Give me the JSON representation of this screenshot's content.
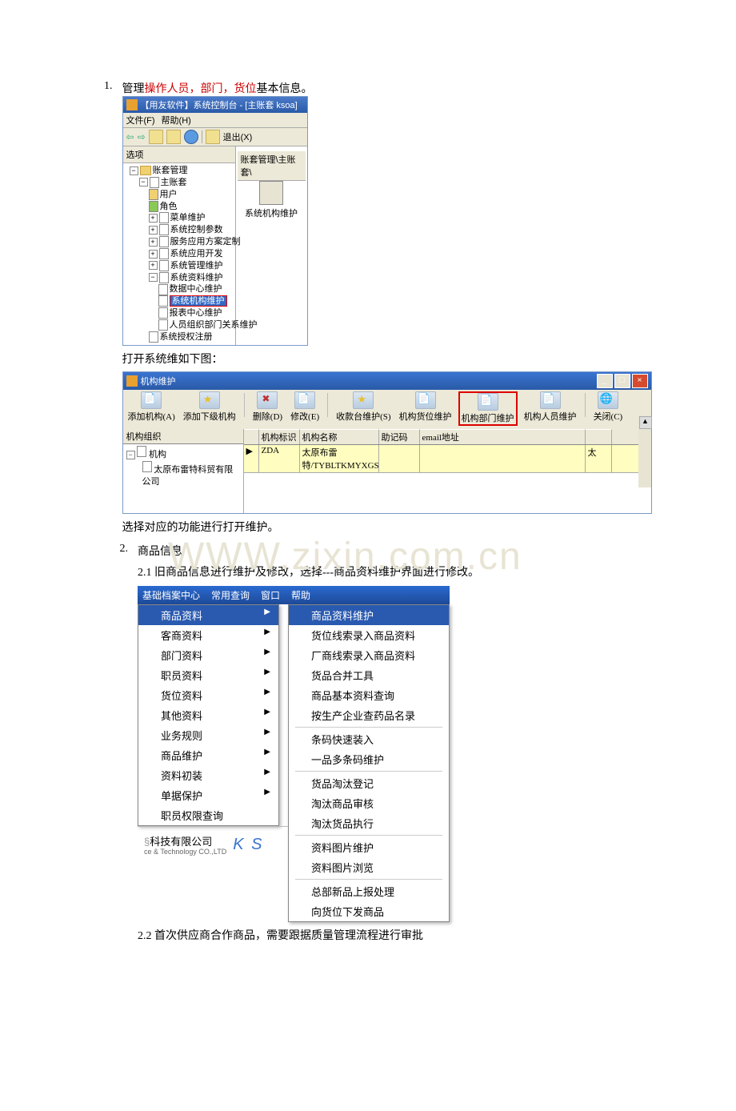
{
  "item1": {
    "number": "1.",
    "text_prefix": "管理",
    "red1": "操作人员，",
    "red2": "部门，",
    "red3": "货位",
    "text_suffix": "基本信息。"
  },
  "win1": {
    "title": "【用友软件】系统控制台 - [主账套 ksoa]",
    "menu": {
      "file": "文件(F)",
      "help": "帮助(H)"
    },
    "toolbar": {
      "exit": "退出(X)"
    },
    "left_header": "选项",
    "right_header": "账套管理\\主账套\\",
    "right_label": "系统机构维护",
    "tree": {
      "root": "账套管理",
      "main": "主账套",
      "user": "用户",
      "role": "角色",
      "menu_maint": "菜单维护",
      "sys_param": "系统控制参数",
      "svc_custom": "服务应用方案定制",
      "app_dev": "系统应用开发",
      "mgmt_maint": "系统管理维护",
      "data_maint": "系统资料维护",
      "data_center": "数据中心维护",
      "org_maint": "系统机构维护",
      "report_maint": "报表中心维护",
      "staff_rel": "人员组织部门关系维护",
      "auth_reg": "系统授权注册"
    }
  },
  "line_under_win1": "打开系统维如下图：",
  "win2": {
    "title": "机构维护",
    "toolbar": {
      "add": "添加机构(A)",
      "add_sub": "添加下级机构",
      "del": "删除(D)",
      "modify": "修改(E)",
      "pos_maint": "收款台维护(S)",
      "loc_maint": "机构货位维护",
      "dept_maint": "机构部门维护",
      "staff_maint": "机构人员维护",
      "close": "关闭(C)"
    },
    "tree_header": "机构组织",
    "tree_root": "机构",
    "tree_child": "太原布雷特科贸有限公司",
    "cols": {
      "c1": "机构标识",
      "c2": "机构名称",
      "c3": "助记码",
      "c4": "email地址"
    },
    "row": {
      "c1": "ZDA",
      "c2": "太原布雷特/TYBLTKMYXGS",
      "c5": "太"
    }
  },
  "line_under_win2": "选择对应的功能进行打开维护。",
  "item2": {
    "number": "2.",
    "title": "商品信息",
    "line21": "2.1 旧商品信息进行维护及修改，选择---商品资料维护界面进行修改。"
  },
  "watermark": "WWW.zixin.com.cn",
  "win3": {
    "menubar": {
      "m1": "基础档案中心",
      "m2": "常用查询",
      "m3": "窗口",
      "m4": "帮助"
    },
    "menu1": {
      "i1": "商品资料",
      "i2": "客商资料",
      "i3": "部门资料",
      "i4": "职员资料",
      "i5": "货位资料",
      "i6": "其他资料",
      "i7": "业务规则",
      "i8": "商品维护",
      "i9": "资料初装",
      "i10": "单据保护",
      "i11": "职员权限查询"
    },
    "menu2": {
      "i1": "商品资料维护",
      "i2": "货位线索录入商品资料",
      "i3": "厂商线索录入商品资料",
      "i4": "货品合并工具",
      "i5": "商品基本资料查询",
      "i6": "按生产企业查药品名录",
      "i7": "条码快速装入",
      "i8": "一品多条码维护",
      "i9": "货品淘汰登记",
      "i10": "淘汰商品审核",
      "i11": "淘汰货品执行",
      "i12": "资料图片维护",
      "i13": "资料图片浏览",
      "i14": "总部新品上报处理",
      "i15": "向货位下发商品"
    },
    "bottom": {
      "company_cn": "科技有限公司",
      "company_en": "ce & Technology CO.,LTD",
      "ks": "K S"
    }
  },
  "line22": "2.2 首次供应商合作商品，需要跟据质量管理流程进行审批"
}
